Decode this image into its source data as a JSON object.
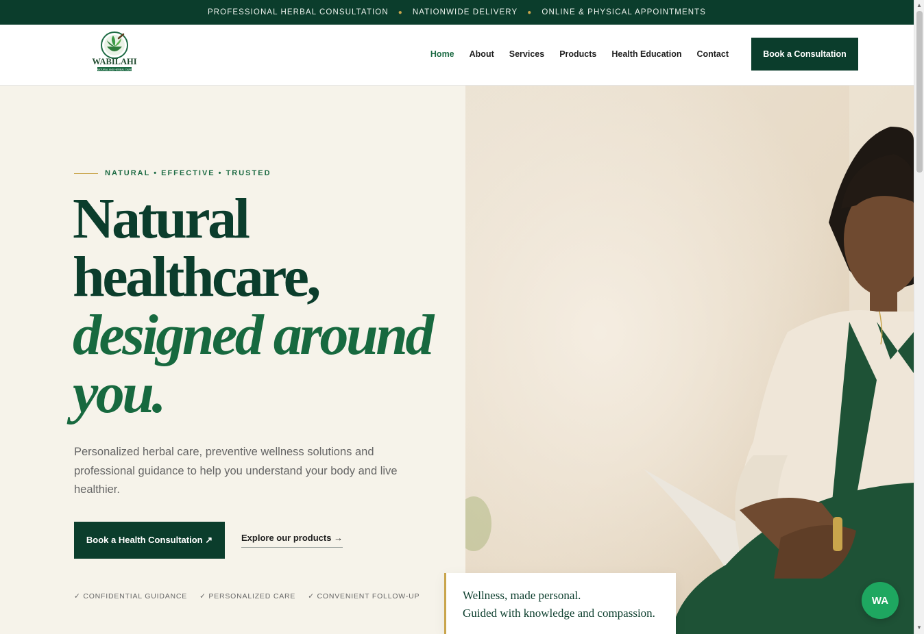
{
  "topbar": {
    "items": [
      "PROFESSIONAL HERBAL CONSULTATION",
      "NATIONWIDE DELIVERY",
      "ONLINE & PHYSICAL APPOINTMENTS"
    ]
  },
  "header": {
    "logo_text": "WABILAHI",
    "logo_subtext": "NATURAL AND HERBAL CARE",
    "nav": [
      "Home",
      "About",
      "Services",
      "Products",
      "Health Education",
      "Contact"
    ],
    "cta": "Book a Consultation"
  },
  "hero": {
    "eyebrow": "NATURAL • EFFECTIVE • TRUSTED",
    "headline_line1": "Natural",
    "headline_line2": "healthcare,",
    "headline_italic1": "designed around",
    "headline_italic2": "you.",
    "lead": "Personalized herbal care, preventive wellness solutions and professional guidance to help you understand your body and live healthier.",
    "primary_cta": "Book a Health Consultation ↗",
    "secondary_cta": "Explore our products →",
    "trust": [
      "✓ CONFIDENTIAL GUIDANCE",
      "✓ PERSONALIZED CARE",
      "✓ CONVENIENT FOLLOW-UP"
    ],
    "quote_line1": "Wellness, made personal.",
    "quote_line2": "Guided with knowledge and compassion."
  },
  "floating": {
    "whatsapp_label": "WA"
  },
  "colors": {
    "brand_dark": "#0b3d2c",
    "brand_green": "#1d6b44",
    "accent_gold": "#c9a54c",
    "whatsapp": "#1ea760"
  }
}
